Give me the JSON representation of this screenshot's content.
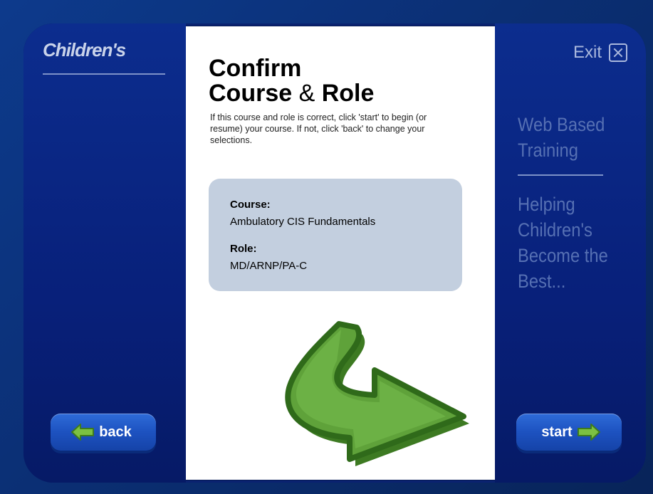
{
  "brand": {
    "logo_text": "Children's"
  },
  "exit": {
    "label": "Exit",
    "icon": "close-icon"
  },
  "main": {
    "title_line1": "Confirm",
    "title_line2_a": "Course",
    "title_line2_amp": "&",
    "title_line2_b": "Role",
    "instructions": "If this course and role is correct, click 'start' to begin (or resume) your course. If not, click 'back' to change your selections.",
    "course_label": "Course:",
    "course_value": "Ambulatory CIS Fundamentals",
    "role_label": "Role:",
    "role_value": "MD/ARNP/PA-C"
  },
  "sidebar_right": {
    "heading": "Web Based Training",
    "tagline": "Helping Children's Become the Best..."
  },
  "buttons": {
    "back_label": "back",
    "start_label": "start",
    "back_icon": "arrow-left-icon",
    "start_icon": "arrow-right-icon"
  },
  "colors": {
    "panel_background": "#ffffff",
    "info_box": "#c3cfdf",
    "arrow_green": "#5fa23a",
    "button_blue": "#1d52c0",
    "sidebar_text": "#5670b3"
  }
}
